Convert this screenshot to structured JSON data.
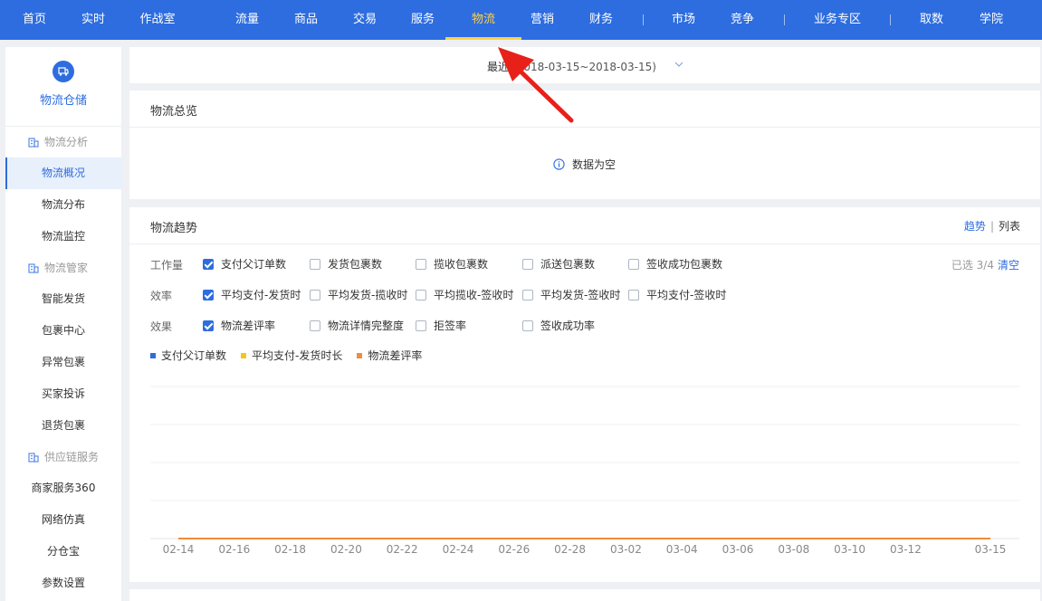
{
  "topnav": {
    "items": [
      {
        "label": "首页",
        "active": false
      },
      {
        "label": "实时",
        "active": false
      },
      {
        "label": "作战室",
        "active": false
      },
      {
        "label": "流量",
        "active": false
      },
      {
        "label": "商品",
        "active": false
      },
      {
        "label": "交易",
        "active": false
      },
      {
        "label": "服务",
        "active": false
      },
      {
        "label": "物流",
        "active": true
      },
      {
        "label": "营销",
        "active": false
      },
      {
        "label": "财务",
        "active": false
      },
      {
        "label": "市场",
        "active": false
      },
      {
        "label": "竞争",
        "active": false
      },
      {
        "label": "业务专区",
        "active": false
      },
      {
        "label": "取数",
        "active": false
      },
      {
        "label": "学院",
        "active": false
      }
    ]
  },
  "sidebar": {
    "brand": {
      "title": "物流仓储",
      "icon": "truck-icon"
    },
    "groups": [
      {
        "label": "物流分析",
        "icon": "building-icon",
        "items": [
          "物流概况",
          "物流分布",
          "物流监控"
        ]
      },
      {
        "label": "物流管家",
        "icon": "building-icon",
        "items": [
          "智能发货",
          "包裹中心",
          "异常包裹",
          "买家投诉",
          "退货包裹"
        ]
      },
      {
        "label": "供应链服务",
        "icon": "building-icon",
        "items": [
          "商家服务360",
          "网络仿真",
          "分仓宝",
          "参数设置"
        ]
      }
    ],
    "active_item": "物流概况"
  },
  "datebar": {
    "prefix": "最近",
    "range": "(2018-03-15~2018-03-15)"
  },
  "overview": {
    "title": "物流总览",
    "empty_text": "数据为空"
  },
  "trend": {
    "title": "物流趋势",
    "tabs": {
      "trend": "趋势",
      "list": "列表"
    },
    "selected_info": "已选 3/4",
    "clear_label": "清空",
    "rows": [
      {
        "label": "工作量",
        "options": [
          {
            "label": "支付父订单数",
            "checked": true
          },
          {
            "label": "发货包裹数",
            "checked": false
          },
          {
            "label": "揽收包裹数",
            "checked": false
          },
          {
            "label": "派送包裹数",
            "checked": false
          },
          {
            "label": "签收成功包裹数",
            "checked": false
          }
        ]
      },
      {
        "label": "效率",
        "options": [
          {
            "label": "平均支付-发货时",
            "checked": true
          },
          {
            "label": "平均发货-揽收时",
            "checked": false
          },
          {
            "label": "平均揽收-签收时",
            "checked": false
          },
          {
            "label": "平均发货-签收时",
            "checked": false
          },
          {
            "label": "平均支付-签收时",
            "checked": false
          }
        ]
      },
      {
        "label": "效果",
        "options": [
          {
            "label": "物流差评率",
            "checked": true
          },
          {
            "label": "物流详情完整度",
            "checked": false
          },
          {
            "label": "拒签率",
            "checked": false
          },
          {
            "label": "签收成功率",
            "checked": false
          }
        ]
      }
    ],
    "legend": [
      {
        "label": "支付父订单数",
        "color": "#2d6ddf"
      },
      {
        "label": "平均支付-发货时长",
        "color": "#f5c518"
      },
      {
        "label": "物流差评率",
        "color": "#f08c3c"
      }
    ]
  },
  "chart_data": {
    "type": "line",
    "x_ticks": [
      "02-14",
      "02-16",
      "02-18",
      "02-20",
      "02-22",
      "02-24",
      "02-26",
      "02-28",
      "03-02",
      "03-04",
      "03-06",
      "03-08",
      "03-10",
      "03-12",
      "03-15"
    ],
    "x_range": [
      "02-14",
      "03-15"
    ],
    "grid": true,
    "series": [
      {
        "name": "支付父订单数",
        "color": "#2d6ddf",
        "values": [
          0,
          0
        ]
      },
      {
        "name": "平均支付-发货时长",
        "color": "#f5c518",
        "values": [
          0,
          0
        ]
      },
      {
        "name": "物流差评率",
        "color": "#f08c3c",
        "values": [
          0,
          0
        ]
      }
    ]
  }
}
